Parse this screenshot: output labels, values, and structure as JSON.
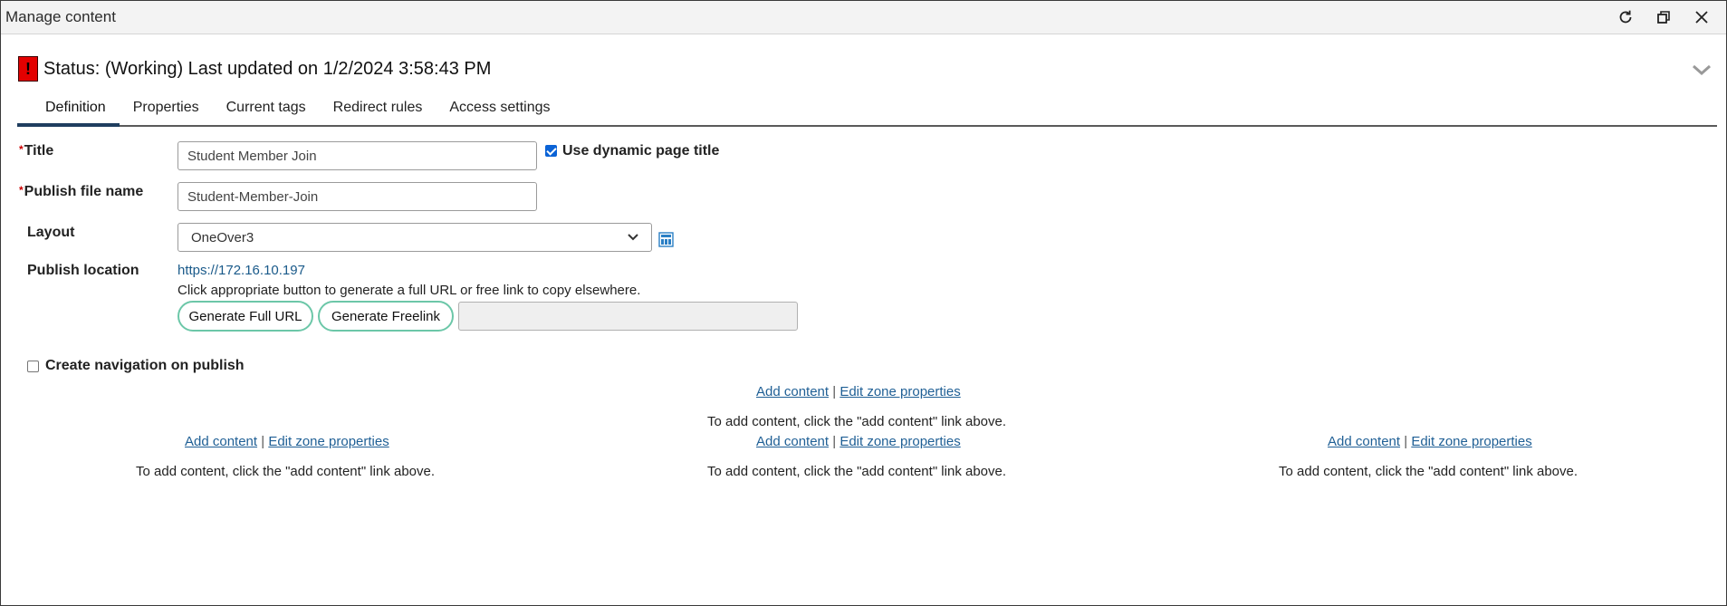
{
  "window": {
    "title": "Manage content",
    "buttons": [
      "refresh-icon",
      "restore-icon",
      "close-icon"
    ]
  },
  "status": {
    "icon_text": "!",
    "text": "Status: (Working) Last updated on 1/2/2024 3:58:43 PM",
    "warn_color": "#e30000"
  },
  "tabs": [
    {
      "label": "Definition",
      "active": true
    },
    {
      "label": "Properties"
    },
    {
      "label": "Current tags"
    },
    {
      "label": "Redirect rules"
    },
    {
      "label": "Access settings"
    }
  ],
  "form": {
    "required_marker": "*",
    "title_label": "Title",
    "title_value": "Student Member Join",
    "dynamic_title_label": "Use dynamic page title",
    "dynamic_title_checked": true,
    "publish_file_label": "Publish file name",
    "publish_file_value": "Student-Member-Join",
    "layout_label": "Layout",
    "layout_value": "OneOver3",
    "publish_location_label": "Publish location",
    "publish_location_url": "https://172.16.10.197",
    "publish_help": "Click appropriate button to generate a full URL or free link to copy elsewhere.",
    "generate_full_url": "Generate Full URL",
    "generate_freelink": "Generate Freelink",
    "generated_value": "",
    "create_nav_label": "Create navigation on publish",
    "create_nav_checked": false
  },
  "zones": {
    "add_content": "Add content",
    "separator": "|",
    "edit_zone": "Edit zone properties",
    "help": "To add content, click the \"add content\" link above."
  },
  "colors": {
    "accent_tab": "#1f3e5f",
    "pill_border": "#6cc7a8",
    "link": "#1f5f95"
  }
}
